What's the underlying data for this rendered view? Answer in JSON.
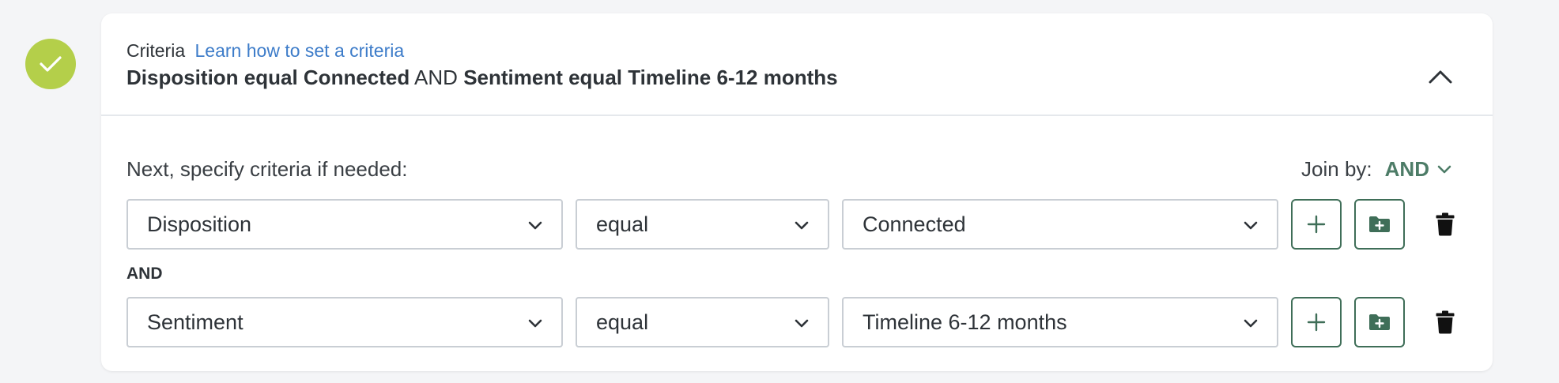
{
  "status": {
    "icon": "check-icon",
    "color": "#b4cf4a"
  },
  "header": {
    "criteria_label": "Criteria",
    "learn_link": "Learn how to set a criteria",
    "summary": {
      "part1": "Disposition equal Connected",
      "joiner": "AND",
      "part2": "Sentiment equal Timeline 6-12 months"
    }
  },
  "body": {
    "instruction": "Next, specify criteria if needed:",
    "join_by_label": "Join by:",
    "join_by_value": "AND",
    "and_separator": "AND",
    "rows": [
      {
        "field": "Disposition",
        "operator": "equal",
        "value": "Connected"
      },
      {
        "field": "Sentiment",
        "operator": "equal",
        "value": "Timeline 6-12 months"
      }
    ]
  },
  "colors": {
    "accent_green": "#4d7c67",
    "link_blue": "#3d7cc9",
    "badge_green": "#b4cf4a"
  }
}
